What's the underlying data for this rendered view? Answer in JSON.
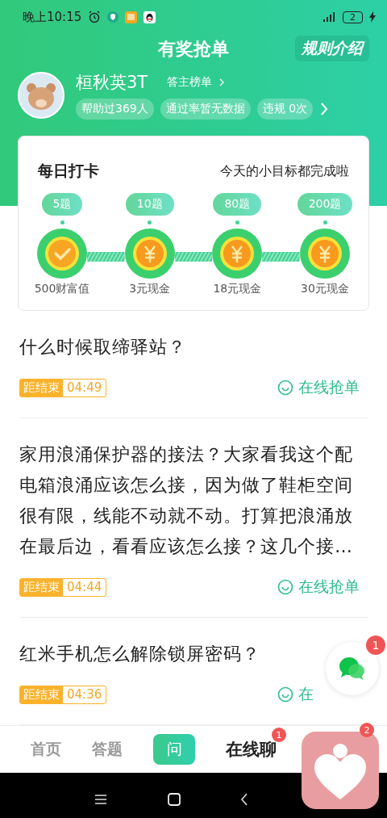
{
  "status_bar": {
    "time": "晚上10:15",
    "battery": "2"
  },
  "header": {
    "title": "有奖抢单",
    "rules_button": "规则介绍"
  },
  "profile": {
    "name": "桓秋英3T",
    "ranking_link": "答主榜单",
    "stats": [
      "帮助过369人",
      "通过率暂无数据",
      "违规 0次"
    ]
  },
  "checkin": {
    "title": "每日打卡",
    "status": "今天的小目标都完成啦",
    "milestones": [
      {
        "goal": "5题",
        "reward": "500财富值",
        "completed": true
      },
      {
        "goal": "10题",
        "reward": "3元现金",
        "completed": false
      },
      {
        "goal": "80题",
        "reward": "18元现金",
        "completed": false
      },
      {
        "goal": "200题",
        "reward": "30元现金",
        "completed": false
      }
    ]
  },
  "questions": [
    {
      "text": "什么时候取缔驿站？",
      "countdown_label": "距结束",
      "countdown": "04:49",
      "action": "在线抢单"
    },
    {
      "text": "家用浪涌保护器的接法？大家看我这个配电箱浪涌应该怎么接，因为做了鞋柜空间很有限，线能不动就不动。打算把浪涌放在最后边，看看应该怎么接？这几个接…",
      "countdown_label": "距结束",
      "countdown": "04:44",
      "action": "在线抢单"
    },
    {
      "text": "红米手机怎么解除锁屏密码？",
      "countdown_label": "距结束",
      "countdown": "04:36",
      "action": "在"
    }
  ],
  "float_chat": {
    "badge": "1"
  },
  "bottom_nav": [
    {
      "label": "首页",
      "kind": "tab",
      "selected": false
    },
    {
      "label": "答题",
      "kind": "tab",
      "selected": false
    },
    {
      "label": "问",
      "kind": "ask"
    },
    {
      "label": "在线聊",
      "kind": "tab",
      "selected": true,
      "badge": "1"
    }
  ],
  "covered_tab_badge": "2"
}
